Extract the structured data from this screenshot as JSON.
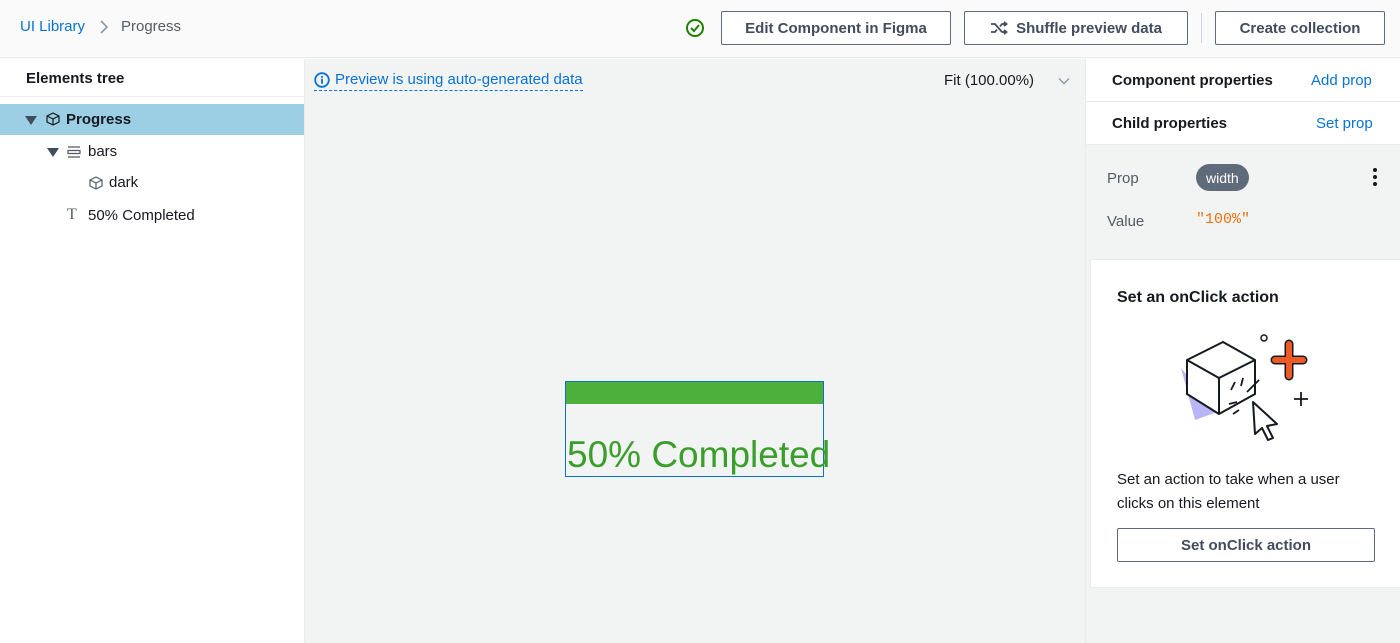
{
  "breadcrumb": {
    "root": "UI Library",
    "current": "Progress"
  },
  "toolbar": {
    "edit_figma": "Edit Component in Figma",
    "shuffle": "Shuffle preview data",
    "create_collection": "Create collection",
    "status": "check-circle-icon"
  },
  "elements_tree": {
    "title": "Elements tree",
    "items": [
      {
        "label": "Progress",
        "icon": "cube-icon",
        "selected": true
      },
      {
        "label": "bars",
        "icon": "flex-rows-icon",
        "selected": false
      },
      {
        "label": "dark",
        "icon": "cube-icon",
        "selected": false
      },
      {
        "label": "50% Completed",
        "icon": "text-icon",
        "selected": false
      }
    ]
  },
  "canvas": {
    "info_link": "Preview is using auto-generated data",
    "zoom": "Fit (100.00%)",
    "preview": {
      "progress_fraction": 1.0,
      "text": "50% Completed",
      "bar_color": "#4daf3c",
      "text_color": "#3a9e2a"
    }
  },
  "right_panel": {
    "component_properties": {
      "title": "Component properties",
      "action": "Add prop"
    },
    "child_properties": {
      "title": "Child properties",
      "action": "Set prop"
    },
    "prop": {
      "label": "Prop",
      "name": "width"
    },
    "value": {
      "label": "Value",
      "value": "\"100%\""
    },
    "onclick_card": {
      "title": "Set an onClick action",
      "description": "Set an action to take when a user clicks on this element",
      "button": "Set onClick action"
    }
  },
  "colors": {
    "accent": "#0972d3",
    "selection": "#9ccfe4",
    "value": "#ec7211"
  }
}
